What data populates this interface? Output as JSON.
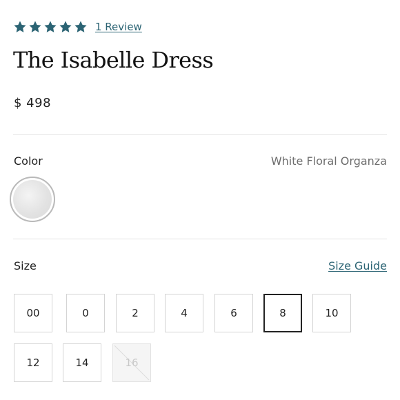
{
  "rating": {
    "stars": 5,
    "max_stars": 5,
    "review_link": "1 Review",
    "star_color": "#2c6474"
  },
  "product": {
    "title": "The Isabelle Dress",
    "price": "$ 498"
  },
  "color": {
    "label": "Color",
    "selected_value": "White Floral Organza",
    "swatch_icon": "floral-swatch"
  },
  "size": {
    "label": "Size",
    "guide_link": "Size Guide",
    "options": [
      "00",
      "0",
      "2",
      "4",
      "6",
      "8",
      "10",
      "12",
      "14",
      "16"
    ],
    "selected": "8",
    "unavailable": [
      "16"
    ]
  }
}
